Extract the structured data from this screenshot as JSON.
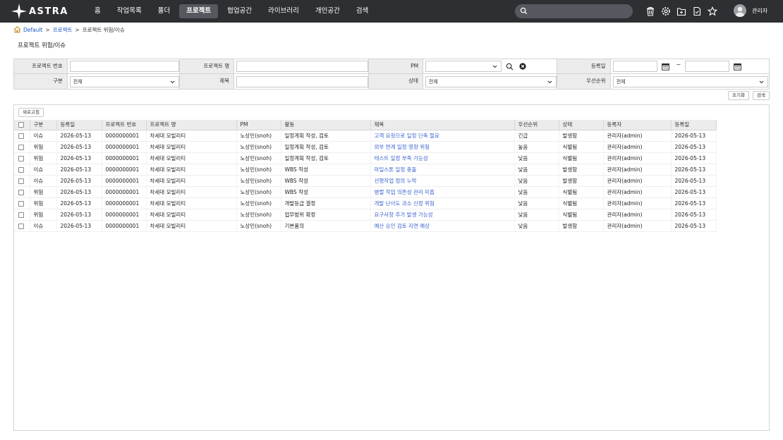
{
  "app": {
    "logo_text": "ASTRA",
    "user_name": "관리자"
  },
  "nav": [
    "홈",
    "작업목록",
    "폴더",
    "프로젝트",
    "협업공간",
    "라이브러리",
    "개인공간",
    "검색"
  ],
  "search": {
    "placeholder": ""
  },
  "breadcrumb": {
    "home": "Default",
    "sep": ">",
    "section": "프로젝트",
    "current": "프로젝트 위험/이슈"
  },
  "page_title": "프로젝트 위험/이슈",
  "filters": {
    "project_no_label": "프로젝트 번호",
    "project_name_label": "프로젝트 명",
    "pm_label": "PM",
    "reg_date_label": "등록일",
    "date_sep": "~",
    "type_label": "구분",
    "type_value": "전체",
    "title_label": "제목",
    "status_label": "상태",
    "status_value": "전체",
    "priority_label": "우선순위",
    "priority_value": "전체"
  },
  "buttons": {
    "reset": "초기화",
    "search": "검색",
    "refresh": "새로고침"
  },
  "table": {
    "headers": [
      "구분",
      "등록일",
      "프로젝트 번호",
      "프로젝트 명",
      "PM",
      "활동",
      "제목",
      "우선순위",
      "상태",
      "등록자",
      "등록일"
    ],
    "rows": [
      [
        "이슈",
        "2026-05-13",
        "0000000001",
        "차세대 모빌리티",
        "노상민(snoh)",
        "일정계획 작성, 검토",
        "고객 요청으로 일정 단축 필요",
        "긴급",
        "발생함",
        "관리자(admin)",
        "2026-05-13"
      ],
      [
        "위험",
        "2026-05-13",
        "0000000001",
        "차세대 모빌리티",
        "노상민(snoh)",
        "일정계획 작성, 검토",
        "외부 연계 일정 영향 위험",
        "높음",
        "식별됨",
        "관리자(admin)",
        "2026-05-13"
      ],
      [
        "위험",
        "2026-05-13",
        "0000000001",
        "차세대 모빌리티",
        "노상민(snoh)",
        "일정계획 작성, 검토",
        "테스트 일정 부족 가능성",
        "낮음",
        "식별됨",
        "관리자(admin)",
        "2026-05-13"
      ],
      [
        "이슈",
        "2026-05-13",
        "0000000001",
        "차세대 모빌리티",
        "노상민(snoh)",
        "WBS 작성",
        "마일스톤 일정 충돌",
        "낮음",
        "발생함",
        "관리자(admin)",
        "2026-05-13"
      ],
      [
        "이슈",
        "2026-05-13",
        "0000000001",
        "차세대 모빌리티",
        "노상민(snoh)",
        "WBS 작성",
        "선행작업 정의 누락",
        "낮음",
        "발생함",
        "관리자(admin)",
        "2026-05-13"
      ],
      [
        "위험",
        "2026-05-13",
        "0000000001",
        "차세대 모빌리티",
        "노상민(snoh)",
        "WBS 작성",
        "병렬 작업 의존성 관리 미흡",
        "낮음",
        "식별됨",
        "관리자(admin)",
        "2026-05-13"
      ],
      [
        "위험",
        "2026-05-13",
        "0000000001",
        "차세대 모빌리티",
        "노상민(snoh)",
        "개발등급 결정",
        "개발 난이도 과소 산정 위험",
        "낮음",
        "식별됨",
        "관리자(admin)",
        "2026-05-13"
      ],
      [
        "위험",
        "2026-05-13",
        "0000000001",
        "차세대 모빌리티",
        "노상민(snoh)",
        "업무범위 확정",
        "요구사항 추가 발생 가능성",
        "낮음",
        "식별됨",
        "관리자(admin)",
        "2026-05-13"
      ],
      [
        "이슈",
        "2026-05-13",
        "0000000001",
        "차세대 모빌리티",
        "노상민(snoh)",
        "기본품의",
        "예산 승인 검토 지연 예상",
        "낮음",
        "발생함",
        "관리자(admin)",
        "2026-05-13"
      ]
    ]
  },
  "colors": {
    "topbar": "#2e2f33",
    "active_nav": "#55585e",
    "link": "#3b63cf",
    "label_bg": "#ececec"
  }
}
